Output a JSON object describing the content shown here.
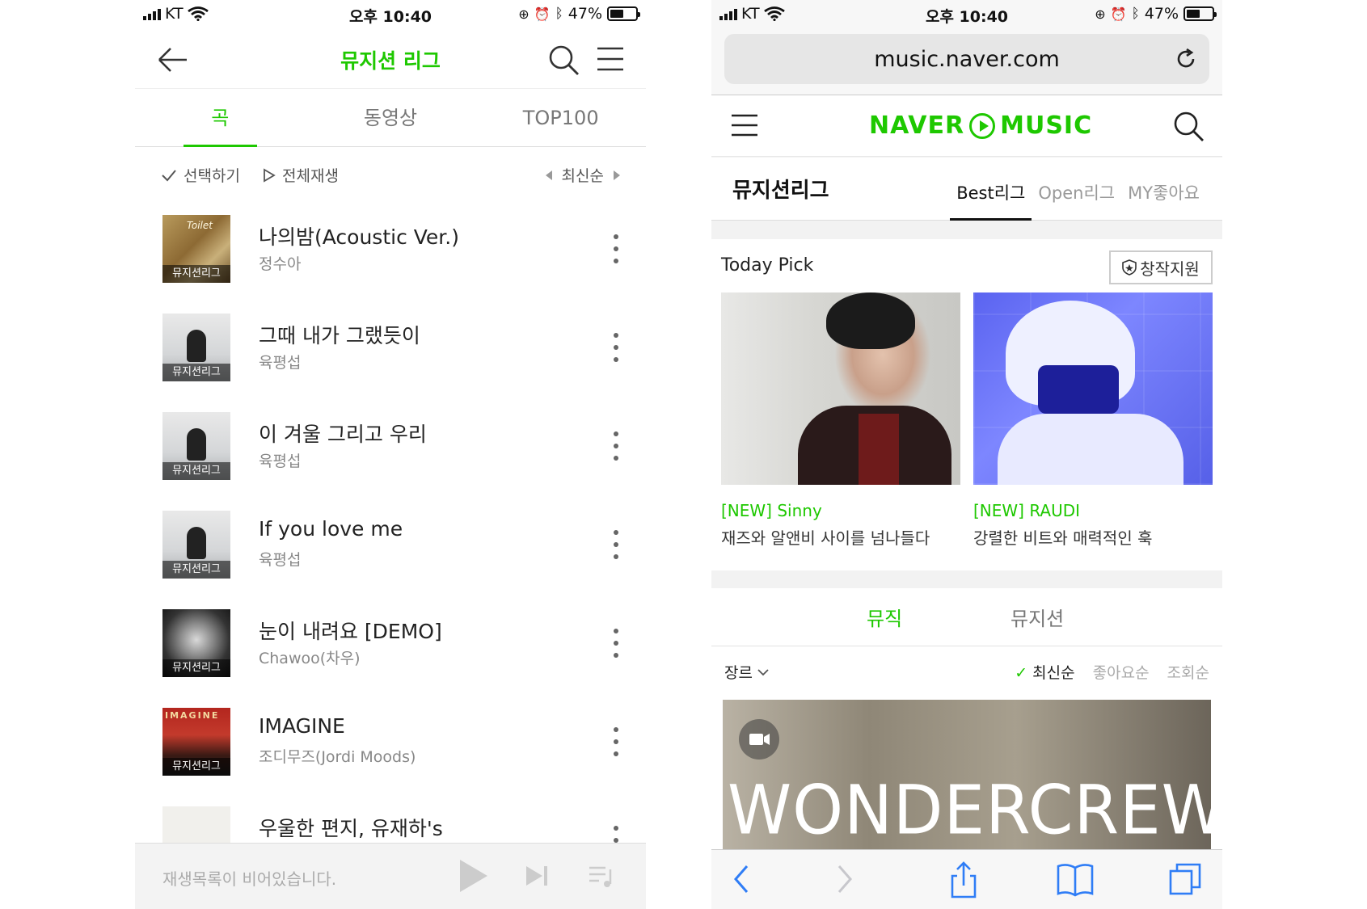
{
  "status_bar": {
    "carrier": "KT",
    "time": "오후 10:40",
    "battery": "47%",
    "battery_level": 0.47
  },
  "left": {
    "header": {
      "title": "뮤지션 리그"
    },
    "tabs": [
      {
        "label": "곡"
      },
      {
        "label": "동영상"
      },
      {
        "label": "TOP100"
      }
    ],
    "toolbar": {
      "select": "선택하기",
      "play_all": "전체재생",
      "sort": "최신순"
    },
    "album_caption": "뮤지션리그",
    "songs": [
      {
        "title": "나의밤(Acoustic Ver.)",
        "artist": "정수아"
      },
      {
        "title": "그때 내가 그랬듯이",
        "artist": "육평섭"
      },
      {
        "title": "이 겨울 그리고 우리",
        "artist": "육평섭"
      },
      {
        "title": "If you love me",
        "artist": "육평섭"
      },
      {
        "title": "눈이 내려요 [DEMO]",
        "artist": "Chawoo(차우)"
      },
      {
        "title": "IMAGINE",
        "artist": "조디무즈(Jordi Moods)"
      },
      {
        "title": "우울한 편지, 유재하's",
        "artist": ""
      }
    ],
    "player": {
      "empty_message": "재생목록이 비어있습니다."
    }
  },
  "right": {
    "url": "music.naver.com",
    "logo": {
      "left": "NAVER",
      "right": "MUSIC"
    },
    "subnav": {
      "title": "뮤지션리그",
      "tabs": [
        {
          "label": "Best리그"
        },
        {
          "label": "Open리그"
        },
        {
          "label": "MY좋아요"
        }
      ]
    },
    "today_pick": {
      "label": "Today Pick",
      "support_button": "창작지원",
      "items": [
        {
          "tag": "[NEW] Sinny",
          "desc": "재즈와 알앤비 사이를 넘나들다"
        },
        {
          "tag": "[NEW] RAUDI",
          "desc": "강렬한 비트와 매력적인 훅"
        }
      ]
    },
    "bottom_tabs": [
      {
        "label": "뮤직"
      },
      {
        "label": "뮤지션"
      }
    ],
    "filters": {
      "genre": "장르",
      "sorts": [
        "최신순",
        "좋아요순",
        "조회순"
      ]
    },
    "video_title": "WONDERCREW"
  },
  "colors": {
    "accent": "#1ec800"
  }
}
